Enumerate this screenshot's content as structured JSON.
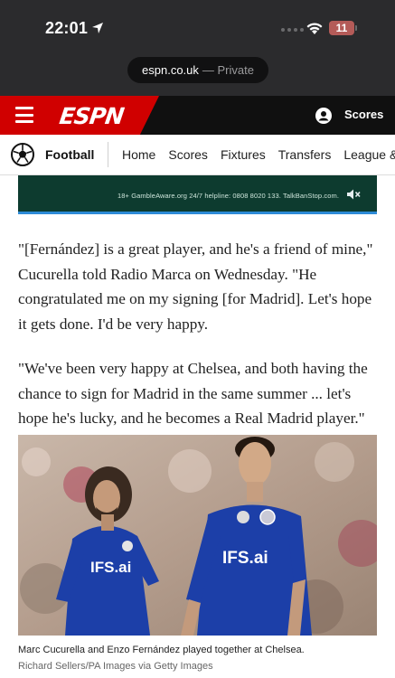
{
  "status_bar": {
    "time": "22:01",
    "battery": "11"
  },
  "browser": {
    "domain": "espn.co.uk",
    "private_label": "— Private"
  },
  "header": {
    "logo": "ESPN",
    "scores_label": "Scores",
    "brand_color": "#d00000"
  },
  "sub_nav": {
    "section": "Football",
    "items": [
      "Home",
      "Scores",
      "Fixtures",
      "Transfers",
      "League & C"
    ]
  },
  "ad": {
    "text": "18+ GambleAware.org 24/7 helpline: 0808 8020 133. TalkBanStop.com."
  },
  "article": {
    "paragraphs": [
      "\"[Fernández] is a great player, and he's a friend of mine,\" Cucurella told Radio Marca on Wednesday. \"He congratulated me on my signing [for Madrid]. Let's hope it gets done. I'd be very happy.",
      "\"We've been very happy at Chelsea, and both having the chance to sign for Madrid in the same summer ... let's hope he's lucky, and he becomes a Real Madrid player.\""
    ]
  },
  "photo": {
    "shirt_sponsor": "IFS.ai",
    "caption": "Marc Cucurella and Enzo Fernández played together at Chelsea.",
    "credit": "Richard Sellers/PA Images via Getty Images"
  },
  "icons": [
    "location-arrow-icon",
    "wifi-icon",
    "menu-icon",
    "user-icon",
    "football-icon",
    "mute-icon"
  ]
}
